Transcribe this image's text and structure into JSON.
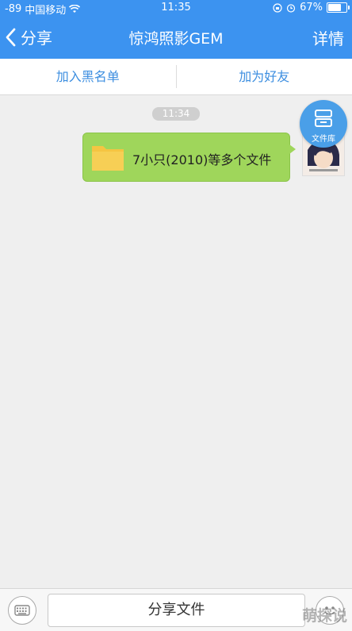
{
  "status_bar": {
    "signal": "-89",
    "carrier": "中国移动",
    "time": "11:35",
    "battery": "67%",
    "battery_level": 0.67
  },
  "nav": {
    "back_label": "分享",
    "title": "惊鸿照影GEM",
    "detail_label": "详情"
  },
  "actions": {
    "blacklist": "加入黑名单",
    "add_friend": "加为好友"
  },
  "chat": {
    "timestamp": "11:34",
    "message": "7小只(2010)等多个文件",
    "file_library_label": "文件库"
  },
  "bottom": {
    "share_label": "分享文件"
  },
  "watermark": "萌探说",
  "colors": {
    "primary": "#3c93f0",
    "bubble": "#9fd65b",
    "background": "#efefef"
  }
}
